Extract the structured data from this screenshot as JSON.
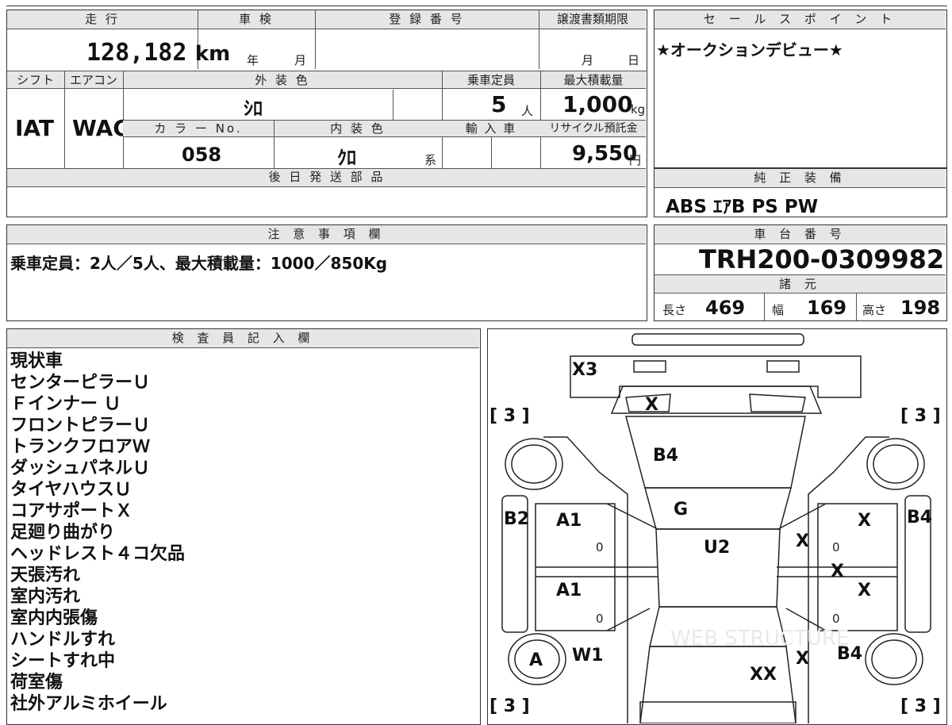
{
  "top_strip": {
    "text": ""
  },
  "mileage": {
    "label": "走 行",
    "value": "128,182",
    "unit": "km"
  },
  "shaken": {
    "label": "車 検",
    "year": "年",
    "month": "月"
  },
  "registration": {
    "label": "登 録 番 号",
    "value": ""
  },
  "transfer": {
    "label": "譲渡書類期限",
    "month": "月",
    "day": "日"
  },
  "shift": {
    "label": "シフト",
    "value": "IAT"
  },
  "aircon": {
    "label": "エアコン",
    "value": "WAC"
  },
  "exterior": {
    "label": "外 装 色",
    "value": "ｼﾛ"
  },
  "capacity": {
    "label": "乗車定員",
    "value": "5",
    "unit": "人"
  },
  "max_load": {
    "label": "最大積載量",
    "value": "1,000",
    "unit": "kg"
  },
  "color_no": {
    "label": "カ ラ ー No.",
    "value": "058"
  },
  "interior": {
    "label": "内 装 色",
    "value": "ｸﾛ",
    "unit": "系"
  },
  "import_car": {
    "label": "輸 入 車",
    "value": ""
  },
  "recycle": {
    "label": "リサイクル預託金",
    "value": "9,550",
    "unit": "円"
  },
  "later_parts": {
    "label": "後 日 発 送 部 品",
    "value": ""
  },
  "sales_point": {
    "label": "セ ー ル ス ポ イ ン ト",
    "text": "★オークションデビュー★"
  },
  "equipment": {
    "label": "純 正 装 備",
    "text": "ABS ｴｱB PS PW"
  },
  "caution": {
    "label": "注 意 事 項 欄",
    "text": "乗車定員：2人／5人、最大積載量：1000／850Kg"
  },
  "chassis": {
    "label": "車 台 番 号",
    "value": "TRH200-0309982"
  },
  "specs": {
    "label": "諸 元",
    "length_label": "長さ",
    "length": "469",
    "width_label": "幅",
    "width": "169",
    "height_label": "高さ",
    "height": "198"
  },
  "inspector": {
    "label": "検 査 員 記 入 欄",
    "notes": [
      "現状車",
      "センターピラーＵ",
      "Ｆインナー Ｕ",
      "フロントピラーＵ",
      "トランクフロアＷ",
      "ダッシュパネルＵ",
      "タイヤハウスＵ",
      "コアサポートＸ",
      "足廻り曲がり",
      "ヘッドレスト４コ欠品",
      "天張汚れ",
      "室内汚れ",
      "室内内張傷",
      "ハンドルすれ",
      "シートすれ中",
      "荷室傷",
      "社外アルミホイール"
    ]
  },
  "diagram_marks": {
    "x3": "X3",
    "x_top": "X",
    "b4_hood": "B4",
    "g": "G",
    "u2": "U2",
    "b2": "B2",
    "a1_fl": "A1",
    "a1_rl": "A1",
    "zero_fl": "0",
    "zero_rl": "0",
    "x_fr": "X",
    "x_fr_outer": "X",
    "x_mid": "X",
    "x_rr": "X",
    "zero_fr": "0",
    "zero_rr": "0",
    "b4_right": "B4",
    "a_wheel": "A",
    "w1": "W1",
    "xx": "XX",
    "x_rear": "X",
    "b4_rear": "B4",
    "tire_fl": "[ 3 ]",
    "tire_fr": "[ 3 ]",
    "tire_rl": "[ 3 ]",
    "tire_rr": "[ 3 ]",
    "watermark": "WEB STRUCTURE"
  }
}
